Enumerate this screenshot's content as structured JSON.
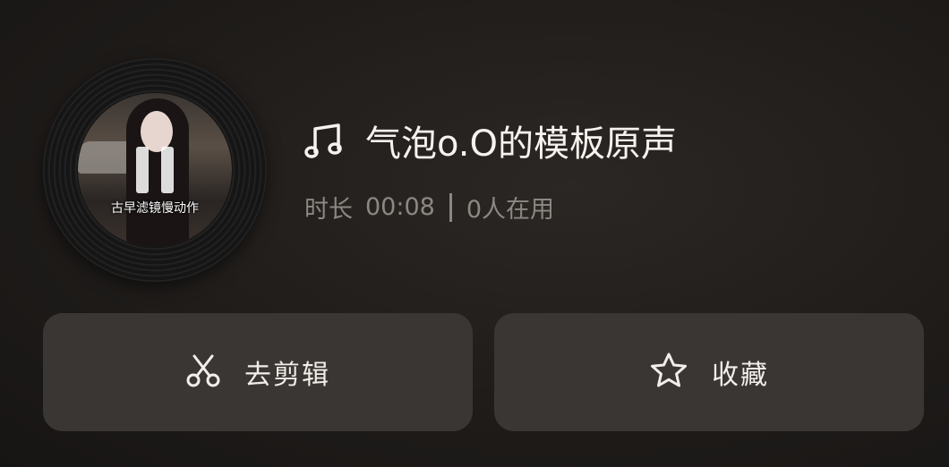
{
  "cover": {
    "caption": "古早滤镜慢动作"
  },
  "track": {
    "title": "气泡o.O的模板原声",
    "duration_label": "时长",
    "duration": "00:08",
    "users": "0人在用"
  },
  "actions": {
    "edit_label": "去剪辑",
    "favorite_label": "收藏"
  },
  "icons": {
    "note": "music-note-icon",
    "pause": "pause-icon",
    "scissors": "scissors-icon",
    "star": "star-icon"
  }
}
